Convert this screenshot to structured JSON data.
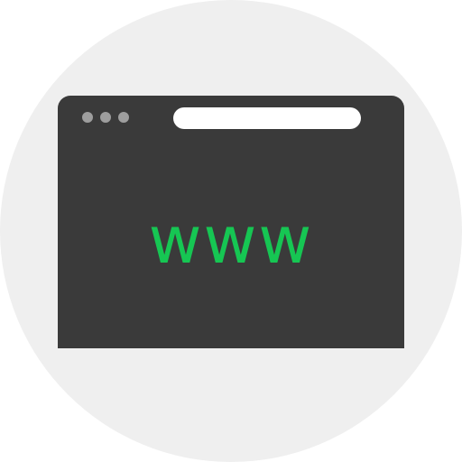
{
  "icon": {
    "name": "www-browser-window-icon",
    "url_text": "www"
  },
  "window": {
    "control_dots": [
      "window-dot-icon",
      "window-dot-icon",
      "window-dot-icon"
    ]
  },
  "colors": {
    "circle_background": "#efefef",
    "window_frame": "#3a3a3a",
    "control_dot": "#9e9e9e",
    "address_bar": "#ffffff",
    "text_accent": "#16c653"
  }
}
